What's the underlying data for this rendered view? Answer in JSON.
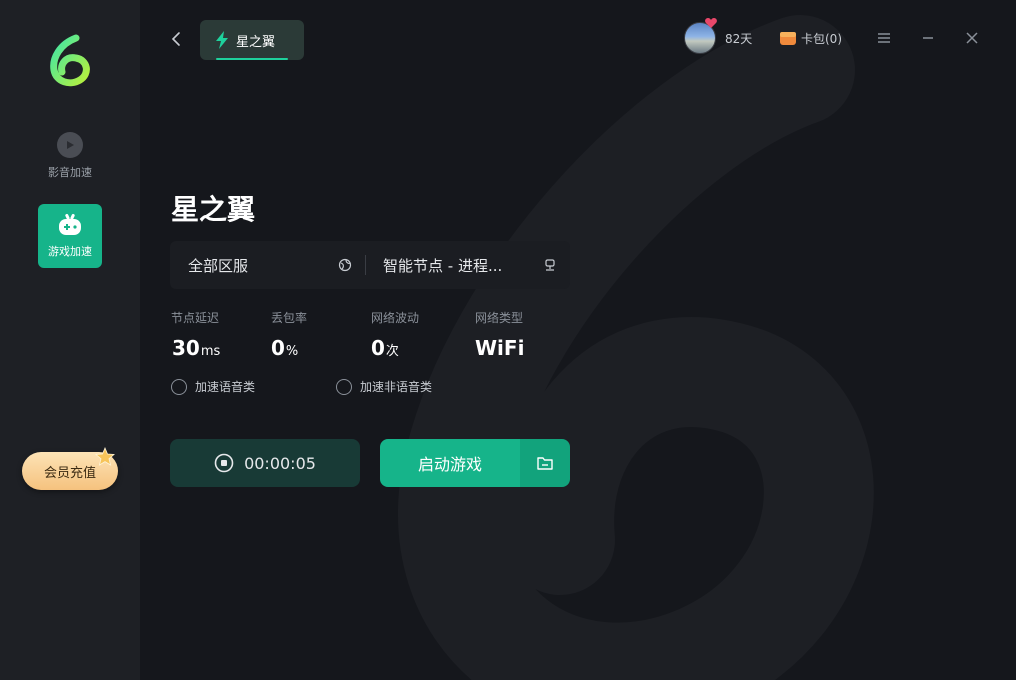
{
  "sidebar": {
    "items": [
      {
        "label": "影音加速",
        "icon": "play-circle-icon"
      },
      {
        "label": "游戏加速",
        "icon": "gamepad-icon"
      }
    ],
    "vip_label": "会员充值"
  },
  "header": {
    "tab_label": "星之翼",
    "days": "82天",
    "wallet": "卡包(0)"
  },
  "game": {
    "title": "星之翼",
    "server": "全部区服",
    "node": "智能节点 - 进程..."
  },
  "stats": [
    {
      "label": "节点延迟",
      "value": "30",
      "unit": "ms"
    },
    {
      "label": "丢包率",
      "value": "0",
      "unit": "%"
    },
    {
      "label": "网络波动",
      "value": "0",
      "unit": "次"
    },
    {
      "label": "网络类型",
      "value": "WiFi",
      "unit": ""
    }
  ],
  "options": {
    "voice": "加速语音类",
    "non_voice": "加速非语音类"
  },
  "actions": {
    "timer": "00:00:05",
    "launch": "启动游戏"
  },
  "colors": {
    "accent": "#16b48a",
    "background": "#15171c",
    "sidebar": "#1e2025"
  }
}
